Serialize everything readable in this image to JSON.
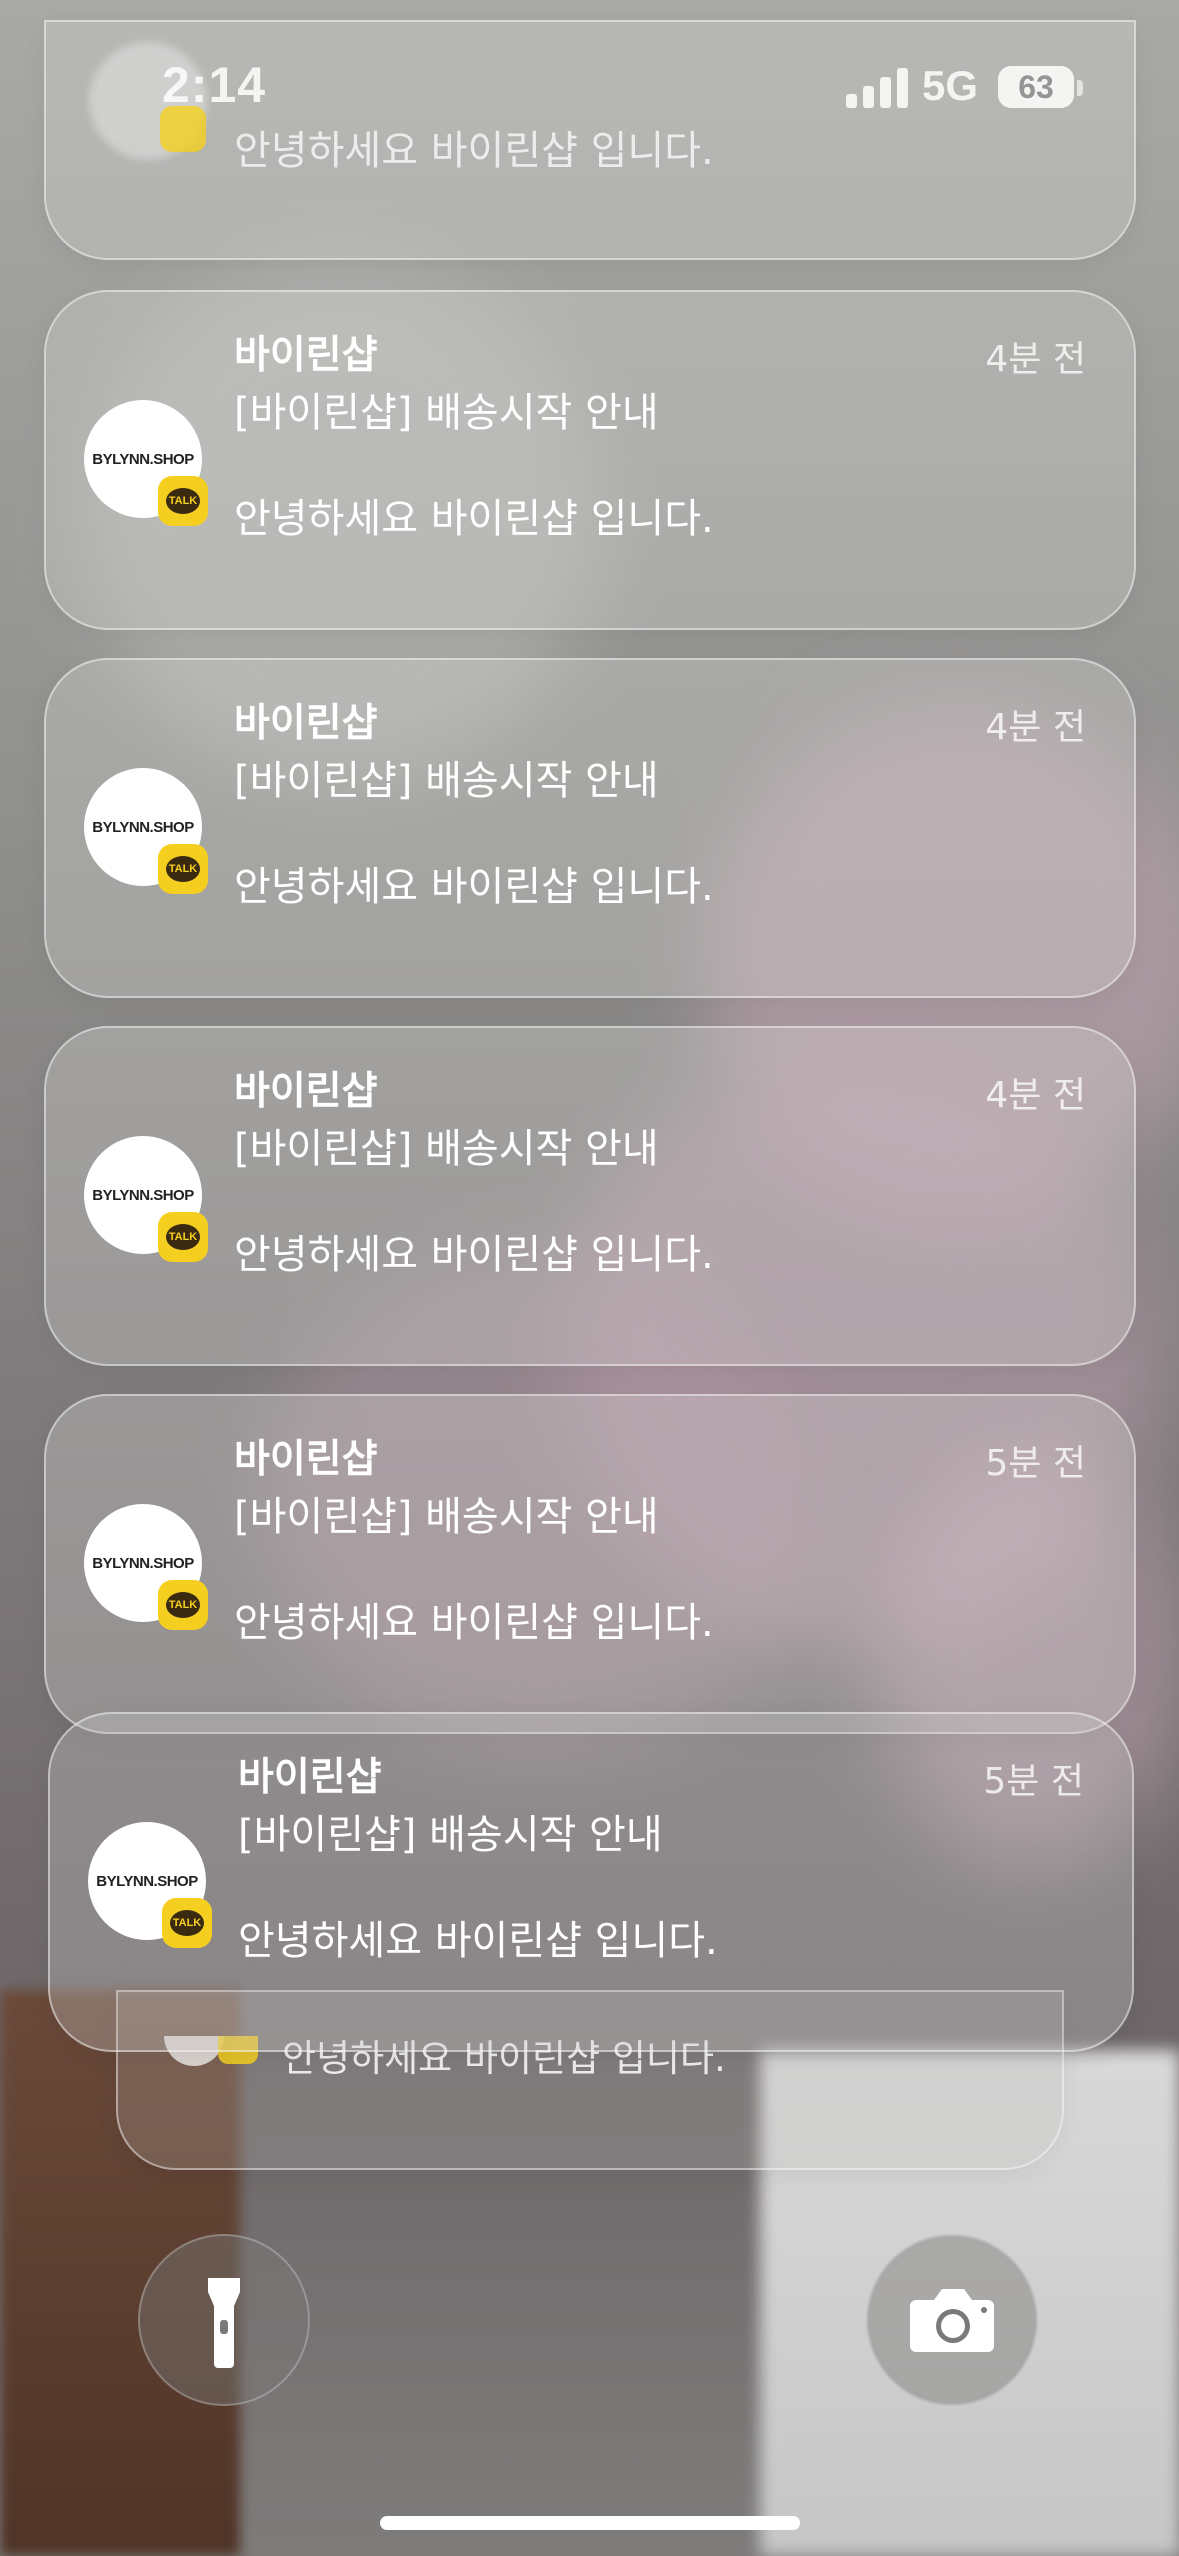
{
  "status_bar": {
    "time": "2:14",
    "network": "5G",
    "battery": "63"
  },
  "top_peek": {
    "body": "안녕하세요 바이린샵 입니다."
  },
  "notifications": [
    {
      "app": "바이린샵",
      "time": "4분 전",
      "title": "[바이린샵] 배송시작 안내",
      "body": "안녕하세요 바이린샵 입니다.",
      "avatar": "BYLYNN.SHOP",
      "badge": "TALK"
    },
    {
      "app": "바이린샵",
      "time": "4분 전",
      "title": "[바이린샵] 배송시작 안내",
      "body": "안녕하세요 바이린샵 입니다.",
      "avatar": "BYLYNN.SHOP",
      "badge": "TALK"
    },
    {
      "app": "바이린샵",
      "time": "4분 전",
      "title": "[바이린샵] 배송시작 안내",
      "body": "안녕하세요 바이린샵 입니다.",
      "avatar": "BYLYNN.SHOP",
      "badge": "TALK"
    },
    {
      "app": "바이린샵",
      "time": "5분 전",
      "title": "[바이린샵] 배송시작 안내",
      "body": "안녕하세요 바이린샵 입니다.",
      "avatar": "BYLYNN.SHOP",
      "badge": "TALK"
    },
    {
      "app": "바이린샵",
      "time": "5분 전",
      "title": "[바이린샵] 배송시작 안내",
      "body": "안녕하세요 바이린샵 입니다.",
      "avatar": "BYLYNN.SHOP",
      "badge": "TALK"
    }
  ],
  "stack_peek": {
    "body": "안녕하세요 바이린샵 입니다."
  },
  "controls": {
    "left_icon": "flashlight-icon",
    "right_icon": "camera-icon"
  }
}
